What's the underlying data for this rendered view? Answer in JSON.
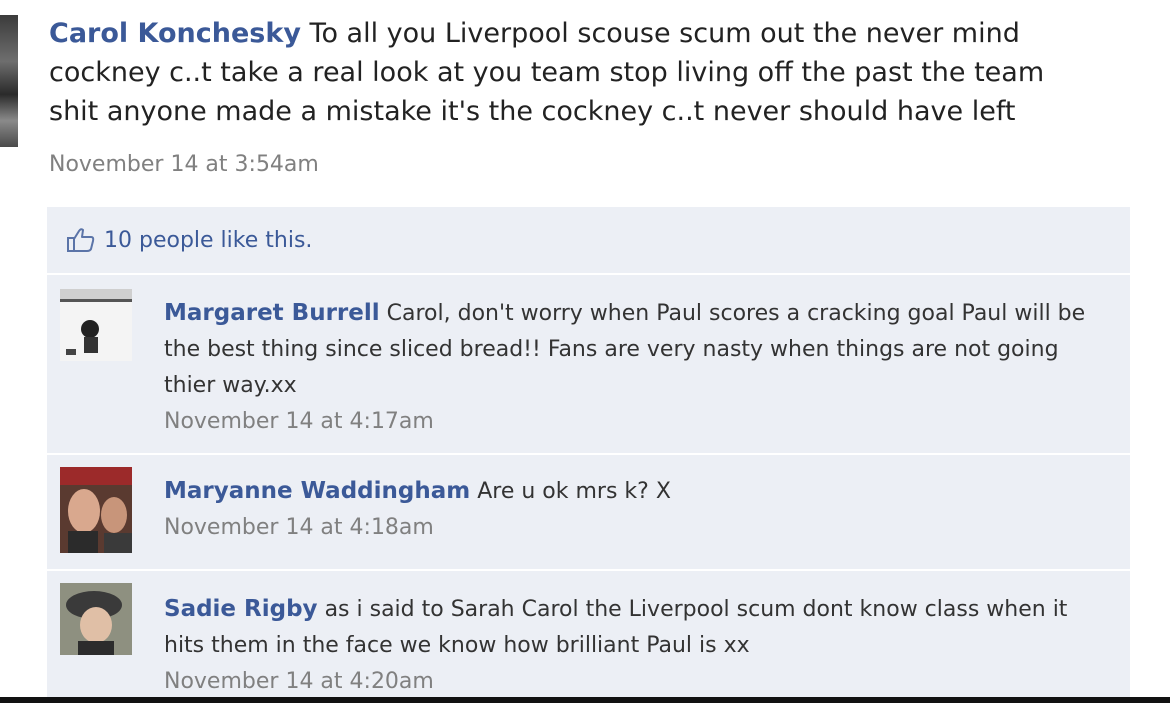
{
  "post": {
    "author": "Carol Konchesky",
    "lines": [
      "To all you Liverpool scouse scum out the never mind",
      "cockney c..t take a real look at you team stop living off the past the team",
      "shit anyone made a mistake it's the cockney c..t never should have left"
    ],
    "time": "November 14 at 3:54am"
  },
  "likes": {
    "text": "10 people like this.",
    "icon": "thumbs-up-icon"
  },
  "comments": [
    {
      "author": "Margaret Burrell",
      "text": "Carol, don't worry when Paul scores a cracking goal Paul will be the best thing since sliced bread!! Fans are very nasty when things are not going thier way.xx",
      "time": "November 14 at 4:17am"
    },
    {
      "author": "Maryanne Waddingham",
      "text": "Are u ok mrs k? X",
      "time": "November 14 at 4:18am"
    },
    {
      "author": "Sadie Rigby",
      "text": "as i said to Sarah Carol the Liverpool scum dont know class when it hits them in the face we know how brilliant Paul is xx",
      "time": "November 14 at 4:20am"
    }
  ],
  "colors": {
    "link": "#3b5998",
    "feedback_bg": "#eceff5",
    "timestamp": "#808080"
  }
}
